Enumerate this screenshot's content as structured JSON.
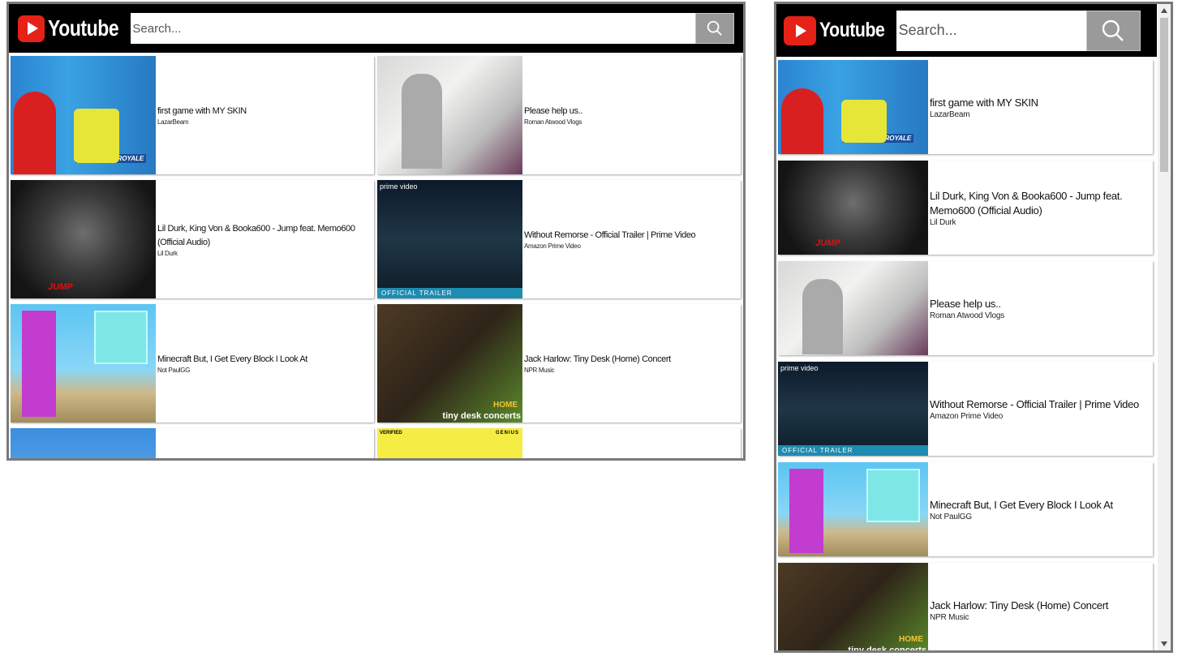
{
  "app": {
    "logo_text": "Youtube",
    "search_placeholder": "Search..."
  },
  "colors": {
    "header_bg": "#000000",
    "logo_red": "#e62117",
    "search_button": "#9a9a9a"
  },
  "wide_view": {
    "videos": [
      {
        "title": "first game with MY SKIN",
        "channel": "LazarBeam",
        "thumb": "t-lazar"
      },
      {
        "title": "Please help us..",
        "channel": "Roman Atwood Vlogs",
        "thumb": "t-roman"
      },
      {
        "title": "Lil Durk, King Von & Booka600 - Jump feat. Memo600 (Official Audio)",
        "channel": "Lil Durk",
        "thumb": "t-lildurk"
      },
      {
        "title": "Without Remorse - Official Trailer | Prime Video",
        "channel": "Amazon Prime Video",
        "thumb": "t-prime"
      },
      {
        "title": "Minecraft But, I Get Every Block I Look At",
        "channel": "Not PaulGG",
        "thumb": "t-mc"
      },
      {
        "title": "Jack Harlow: Tiny Desk (Home) Concert",
        "channel": "NPR Music",
        "thumb": "t-npr"
      },
      {
        "title": "",
        "channel": "",
        "thumb": "t-blue"
      },
      {
        "title": "",
        "channel": "",
        "thumb": "t-yellow"
      }
    ]
  },
  "narrow_view": {
    "videos": [
      {
        "title": "first game with MY SKIN",
        "channel": "LazarBeam",
        "thumb": "t-lazar"
      },
      {
        "title": "Lil Durk, King Von & Booka600 - Jump feat. Memo600 (Official Audio)",
        "channel": "Lil Durk",
        "thumb": "t-lildurk"
      },
      {
        "title": "Please help us..",
        "channel": "Roman Atwood Vlogs",
        "thumb": "t-roman"
      },
      {
        "title": "Without Remorse - Official Trailer | Prime Video",
        "channel": "Amazon Prime Video",
        "thumb": "t-prime"
      },
      {
        "title": "Minecraft But, I Get Every Block I Look At",
        "channel": "Not PaulGG",
        "thumb": "t-mc"
      },
      {
        "title": "Jack Harlow: Tiny Desk (Home) Concert",
        "channel": "NPR Music",
        "thumb": "t-npr"
      }
    ]
  },
  "thumb_labels": {
    "prime": "prime video",
    "trailer": "OFFICIAL TRAILER",
    "jump": "JUMP",
    "tiny_desk": "tiny desk concerts",
    "home": "HOME",
    "victory": "#1 VICTORY ROYALE",
    "verified": "VERIFIED",
    "genius": "GENIUS"
  }
}
